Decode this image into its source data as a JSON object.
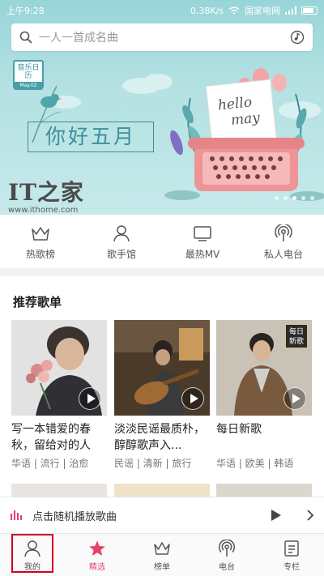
{
  "status_bar": {
    "time": "上午9:28",
    "speed": "0.38K/s",
    "carrier": "国家电网",
    "icons": [
      "wifi-icon",
      "signal-icon",
      "battery-icon"
    ]
  },
  "search": {
    "placeholder": "一人一首成名曲",
    "icon": "search-icon",
    "right_icon": "music-recognize-icon"
  },
  "banner": {
    "calendar_label": "音乐日历",
    "calendar_date": "May.02",
    "greeting": "你好五月",
    "card_text_1": "hello",
    "card_text_2": "may",
    "watermark": "IT之家",
    "watermark_url": "www.ithome.com"
  },
  "quick_nav": [
    {
      "label": "热歌榜",
      "icon": "crown-icon"
    },
    {
      "label": "歌手馆",
      "icon": "person-icon"
    },
    {
      "label": "最热MV",
      "icon": "tv-icon"
    },
    {
      "label": "私人电台",
      "icon": "radio-icon"
    }
  ],
  "recommend": {
    "title": "推荐歌单",
    "playlists": [
      {
        "title": "写一本错爱的春秋，留给对的人",
        "tags": "华语 | 流行 | 治愈"
      },
      {
        "title": "淡淡民谣最质朴，醇醇歌声入...",
        "tags": "民谣 | 清新 | 旅行"
      },
      {
        "title": "每日新歌",
        "tags": "华语 | 欧美 | 韩语",
        "badge": "每日新歌"
      }
    ]
  },
  "mini_player": {
    "text": "点击随机播放歌曲",
    "icons": [
      "waveform-icon",
      "play-icon",
      "chevron-right-icon"
    ]
  },
  "tabs": [
    {
      "label": "我的",
      "icon": "person-icon"
    },
    {
      "label": "精选",
      "icon": "star-icon",
      "active": true
    },
    {
      "label": "榜单",
      "icon": "crown-icon"
    },
    {
      "label": "电台",
      "icon": "radio-icon"
    },
    {
      "label": "专栏",
      "icon": "column-icon"
    }
  ],
  "colors": {
    "accent": "#e6436b",
    "banner_bg": "#b4e1e2",
    "highlight_box": "#d0021b"
  }
}
